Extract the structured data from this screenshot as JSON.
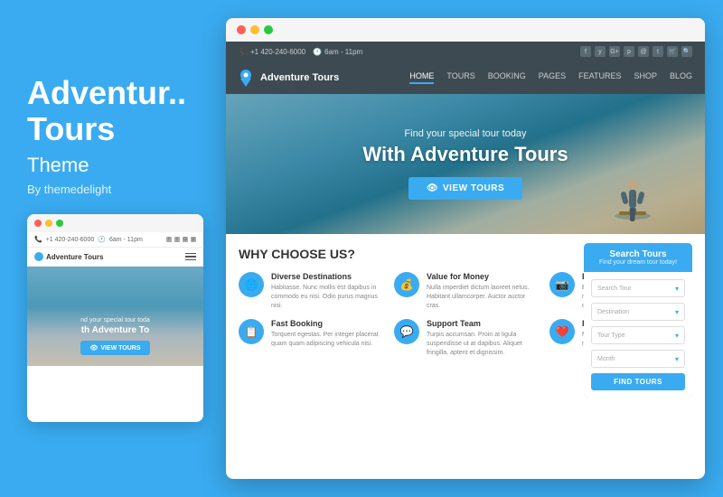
{
  "left": {
    "title_line1": "Adventur..",
    "title_line2": "Tours",
    "subtitle": "Theme",
    "by": "By themedelight"
  },
  "mobile_preview": {
    "dots": [
      "red",
      "yellow",
      "green"
    ],
    "topbar": {
      "phone": "+1 420-240-6000",
      "hours": "6am - 11pm"
    },
    "logo": "Adventure Tours",
    "hero": {
      "subtitle": "nd your special tour toda",
      "title": "th Adventure To"
    },
    "cta_button": "VIEW TOURS"
  },
  "desktop_preview": {
    "dots": [
      "red",
      "yellow",
      "green"
    ],
    "topbar": {
      "phone": "+1 420-240-6000",
      "hours": "6am - 11pm",
      "socials": [
        "f",
        "y",
        "G+",
        "p",
        "@",
        "t",
        "🛒",
        "🔍"
      ]
    },
    "nav": {
      "logo": "Adventure Tours",
      "links": [
        "HOME",
        "TOURS",
        "BOOKING",
        "PAGES",
        "FEATURES",
        "SHOP",
        "BLOG"
      ],
      "active": "HOME"
    },
    "hero": {
      "subtitle": "Find your special tour today",
      "title": "With Adventure Tours",
      "cta": "VIEW TOURS"
    },
    "why_choose_us": {
      "title": "WHY CHOOSE US?",
      "features": [
        {
          "icon": "🌐",
          "title": "Diverse Destinations",
          "text": "Habitasse. Nunc mollis est dapibus in commodo eu nisi. Odio purus magnus nisi."
        },
        {
          "icon": "💰",
          "title": "Value for Money",
          "text": "Nulla imperdiet dictum laoreet netus. Habitant ullamcorper. Auctor auctor cras."
        },
        {
          "icon": "📷",
          "title": "Beautiful Places",
          "text": "Eu molestie Purus ac. Facilisis hac in metus nunc parturient ornare consequat enim."
        },
        {
          "icon": "📋",
          "title": "Fast Booking",
          "text": "Torquent egestas. Per integer placerat quam quam adipiscing vehicula nisi."
        },
        {
          "icon": "💬",
          "title": "Support Team",
          "text": "Turpis accumsan. Proin at ligula suspendisse ut at dapibus. Aliquet fringilla, aptent et dignissim."
        },
        {
          "icon": "❤️",
          "title": "Passionate Travel",
          "text": "Metus cubilia aenean Fusce, dapibus nisi. nullam interdum ut magna."
        }
      ]
    },
    "search_widget": {
      "title": "Search Tours",
      "subtitle": "Find your dream tour today!",
      "fields": [
        {
          "placeholder": "Search Tour"
        },
        {
          "placeholder": "Destination"
        },
        {
          "placeholder": "Tour Type"
        },
        {
          "placeholder": "Month"
        }
      ],
      "button": "FIND TOURS"
    }
  }
}
